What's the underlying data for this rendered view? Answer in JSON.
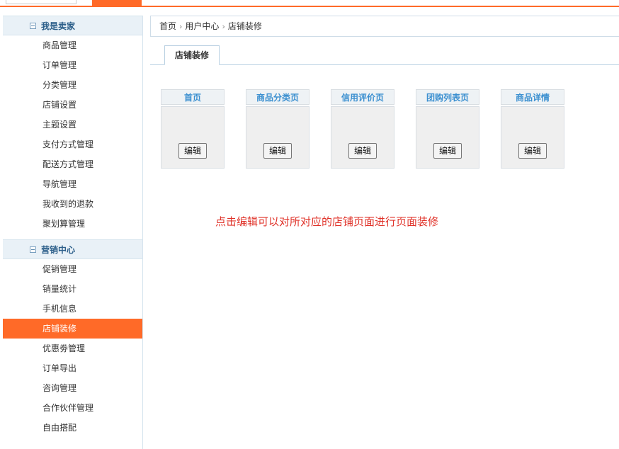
{
  "sidebar": {
    "groups": [
      {
        "title": "我是卖家",
        "items": [
          "商品管理",
          "订单管理",
          "分类管理",
          "店铺设置",
          "主题设置",
          "支付方式管理",
          "配送方式管理",
          "导航管理",
          "我收到的退款",
          "聚划算管理"
        ]
      },
      {
        "title": "营销中心",
        "items": [
          "促销管理",
          "销量统计",
          "手机信息",
          "店铺装修",
          "优惠劵管理",
          "订单导出",
          "咨询管理",
          "合作伙伴管理",
          "自由搭配"
        ]
      }
    ],
    "active_item": "店铺装修"
  },
  "breadcrumb": [
    "首页",
    "用户中心",
    "店铺装修"
  ],
  "tab_label": "店铺装修",
  "pages": [
    {
      "title": "首页",
      "button": "编辑"
    },
    {
      "title": "商品分类页",
      "button": "编辑"
    },
    {
      "title": "信用评价页",
      "button": "编辑"
    },
    {
      "title": "团购列表页",
      "button": "编辑"
    },
    {
      "title": "商品详情",
      "button": "编辑"
    }
  ],
  "note": "点击编辑可以对所对应的店铺页面进行页面装修",
  "colors": {
    "accent": "#ff6a28",
    "note": "#e0332a",
    "page_title": "#3a8fd0"
  }
}
